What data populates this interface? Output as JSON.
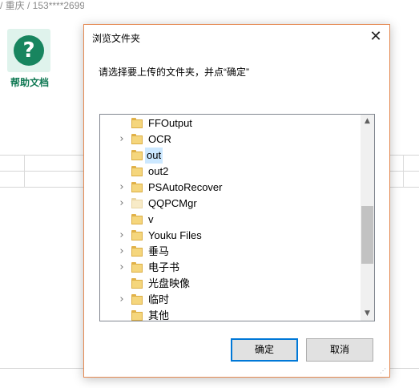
{
  "background": {
    "breadcrumb": "/ 重庆 / 153****2699",
    "help_label": "帮助文档",
    "help_icon_glyph": "?"
  },
  "dialog": {
    "title": "浏览文件夹",
    "close_glyph": "✕",
    "message": "请选择要上传的文件夹，并点“确定”",
    "tree": {
      "items": [
        {
          "label": "FFOutput",
          "expandable": false,
          "selected": false,
          "pale": false
        },
        {
          "label": "OCR",
          "expandable": true,
          "selected": false,
          "pale": false
        },
        {
          "label": "out",
          "expandable": false,
          "selected": true,
          "pale": false
        },
        {
          "label": "out2",
          "expandable": false,
          "selected": false,
          "pale": false
        },
        {
          "label": "PSAutoRecover",
          "expandable": true,
          "selected": false,
          "pale": false
        },
        {
          "label": "QQPCMgr",
          "expandable": true,
          "selected": false,
          "pale": true
        },
        {
          "label": "v",
          "expandable": false,
          "selected": false,
          "pale": false
        },
        {
          "label": "Youku Files",
          "expandable": true,
          "selected": false,
          "pale": false
        },
        {
          "label": "垂马",
          "expandable": true,
          "selected": false,
          "pale": false
        },
        {
          "label": "电子书",
          "expandable": true,
          "selected": false,
          "pale": false
        },
        {
          "label": "光盘映像",
          "expandable": false,
          "selected": false,
          "pale": false
        },
        {
          "label": "临时",
          "expandable": true,
          "selected": false,
          "pale": false
        },
        {
          "label": "其他",
          "expandable": false,
          "selected": false,
          "pale": false
        }
      ],
      "chevron_glyph": "›",
      "scroll_up_glyph": "▲",
      "scroll_down_glyph": "▼"
    },
    "buttons": {
      "ok": "确定",
      "cancel": "取消"
    }
  },
  "colors": {
    "accent": "#0078d7",
    "dialog_border": "#e58b54",
    "selection": "#cce8ff",
    "help_green": "#18855f"
  }
}
